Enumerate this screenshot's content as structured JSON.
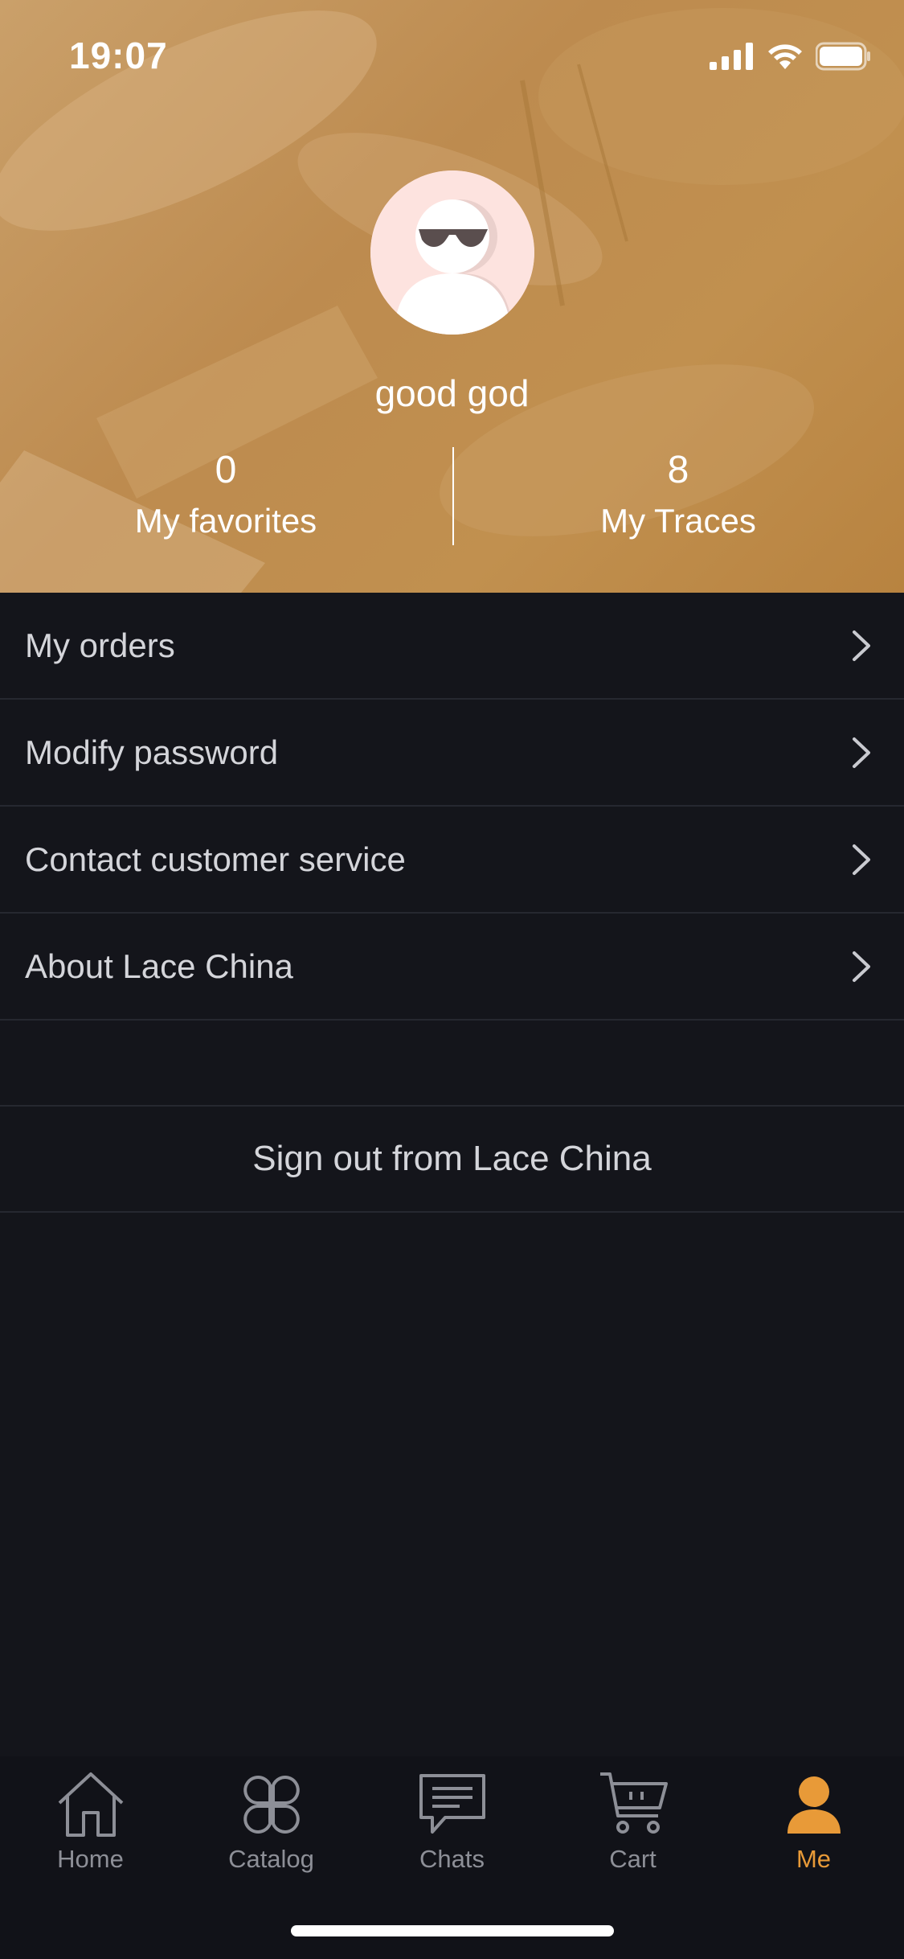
{
  "status_bar": {
    "time": "19:07"
  },
  "profile": {
    "username": "good god",
    "favorites_count": "0",
    "favorites_label": "My favorites",
    "traces_count": "8",
    "traces_label": "My Traces"
  },
  "menu": {
    "items": [
      {
        "label": "My orders"
      },
      {
        "label": "Modify password"
      },
      {
        "label": "Contact customer service"
      },
      {
        "label": "About Lace China"
      }
    ],
    "sign_out_label": "Sign out from Lace China"
  },
  "tabbar": {
    "items": [
      {
        "label": "Home",
        "icon": "home-icon"
      },
      {
        "label": "Catalog",
        "icon": "catalog-icon"
      },
      {
        "label": "Chats",
        "icon": "chat-icon"
      },
      {
        "label": "Cart",
        "icon": "cart-icon"
      },
      {
        "label": "Me",
        "icon": "user-icon",
        "active": true
      }
    ]
  },
  "colors": {
    "accent": "#e89a38",
    "background": "#14151b",
    "header": "#c1904f"
  }
}
